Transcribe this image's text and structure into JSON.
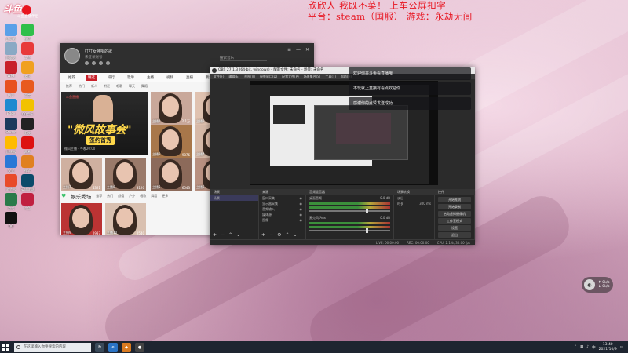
{
  "overlay": {
    "line1": "欣欣人 我既不菜！ 上车公屏扣字",
    "line2": "平台：steam（国服） 游戏：永劫无间"
  },
  "desktop": {
    "logo_text": "斗鱼",
    "logo_sub": "斗鱼直播伴侣",
    "icons": [
      {
        "label": "此电脑",
        "color": "#5aa0e8"
      },
      {
        "label": "微信",
        "color": "#2fbf4a"
      },
      {
        "label": "回收站",
        "color": "#8aa9c4"
      },
      {
        "label": "斗鱼",
        "color": "#e83a3a"
      },
      {
        "label": "WPS",
        "color": "#c8202a"
      },
      {
        "label": "腾讯",
        "color": "#f0a020"
      },
      {
        "label": "快手",
        "color": "#e8501f"
      },
      {
        "label": "百度",
        "color": "#e85a1f"
      },
      {
        "label": "Edge",
        "color": "#1f8ad0"
      },
      {
        "label": "QQ音乐",
        "color": "#f2c200"
      },
      {
        "label": "Steam",
        "color": "#1b3a5c"
      },
      {
        "label": "剪映",
        "color": "#222"
      },
      {
        "label": "加速器",
        "color": "#ffbb00"
      },
      {
        "label": "网易",
        "color": "#d11"
      },
      {
        "label": "安全",
        "color": "#2a78d6"
      },
      {
        "label": "微软",
        "color": "#e08020"
      },
      {
        "label": "浏览器",
        "color": "#e84a2a"
      },
      {
        "label": "英雄联盟",
        "color": "#0a4a6a"
      },
      {
        "label": "游戏",
        "color": "#2a7a4a"
      },
      {
        "label": "斗鱼",
        "color": "#c02040"
      },
      {
        "label": "QQ",
        "color": "#111"
      }
    ]
  },
  "music_app": {
    "user_name": "叮叮女神唱的歌",
    "user_sub": "未登录账号",
    "search_placeholder": "搜索音乐",
    "tabs": [
      "推荐",
      "精选",
      "排行",
      "歌单",
      "主播",
      "视频",
      "直播",
      "我的"
    ],
    "active_tab": "精选",
    "subnav": [
      "推荐",
      "热门",
      "新人",
      "附近",
      "唱歌",
      "聊天",
      "舞蹈"
    ],
    "banner": {
      "tag": "斗鱼直播",
      "title": "\"微风故事会\"",
      "badge": "签约首秀",
      "footer": "微风主播 · 今晚20:00"
    },
    "thumbs": [
      {
        "caption": "主播1",
        "viewers": "2.1万"
      },
      {
        "caption": "主播2",
        "viewers": "1.8万"
      },
      {
        "caption": "主播3",
        "viewers": "9876"
      },
      {
        "caption": "主播4",
        "viewers": "8821"
      },
      {
        "caption": "主播5",
        "viewers": "6543"
      },
      {
        "caption": "主播6",
        "viewers": "5210"
      },
      {
        "caption": "主播7",
        "viewers": "4321"
      },
      {
        "caption": "主播8",
        "viewers": "3120"
      },
      {
        "caption": "主播9",
        "viewers": "2987"
      },
      {
        "caption": "主播10",
        "viewers": "2540"
      }
    ],
    "section_title": "娱乐秀场",
    "section_sub": [
      "推荐",
      "热门",
      "颜值",
      "户外",
      "唱歌",
      "舞蹈",
      "更多"
    ]
  },
  "obs": {
    "title": "OBS 27.1.3 (64-bit, windows) - 配置文件: 未命名 - 场景: 未命名",
    "menu": [
      "文件(F)",
      "编辑(E)",
      "视图(V)",
      "停靠窗口(D)",
      "配置文件(P)",
      "场景集合(S)",
      "工具(T)",
      "帮助(H)"
    ],
    "panels": [
      "场景",
      "来源",
      "音频混音器",
      "场景转换",
      "控件"
    ],
    "scene_items": [
      "场景"
    ],
    "sources": [
      "窗口采集",
      "显示器采集",
      "音频输入",
      "媒体源",
      "图像"
    ],
    "mixer": [
      {
        "name": "桌面音频",
        "level": "0.0 dB"
      },
      {
        "name": "麦克风/Aux",
        "level": "0.0 dB"
      }
    ],
    "transition": {
      "type": "淡出",
      "duration_label": "时长",
      "duration": "300 ms"
    },
    "controls": [
      "开始推流",
      "开始录制",
      "启动虚拟摄像机",
      "工作室模式",
      "设置",
      "退出"
    ],
    "status": [
      "LIVE: 00:00:00",
      "REC: 00:00:00",
      "CPU: 2.1%, 30.00 fps"
    ]
  },
  "chat": [
    "欢迎你来斗鱼看直播哦",
    "不玩就上直接有看点欢迎你",
    "感谢你的点赞发送成功"
  ],
  "widget": {
    "line1": "↑ 0k/s",
    "line2": "↓ 0k/s"
  },
  "taskbar": {
    "search_placeholder": "在这里输入你要搜索的内容",
    "time": "13:40",
    "date": "2021/10/9"
  }
}
